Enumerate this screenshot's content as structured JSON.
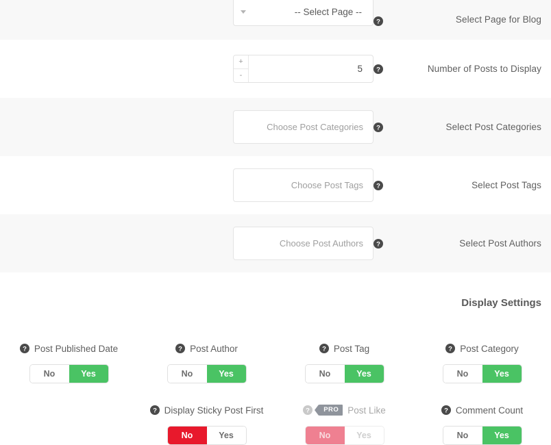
{
  "rows": [
    {
      "label": "Select Page for Blog",
      "control": "select",
      "value": "-- Select Page --",
      "help": "help-icon"
    },
    {
      "label": "Number of Posts to Display",
      "control": "spinner",
      "value": "5",
      "increment_label": "+",
      "decrement_label": "-",
      "help": "help-icon"
    },
    {
      "label": "Select Post Categories",
      "control": "token",
      "placeholder": "Choose Post Categories",
      "help": "help-icon"
    },
    {
      "label": "Select Post Tags",
      "control": "token",
      "placeholder": "Choose Post Tags",
      "help": "help-icon"
    },
    {
      "label": "Select Post Authors",
      "control": "token",
      "placeholder": "Choose Post Authors",
      "help": "help-icon"
    }
  ],
  "display_settings": {
    "heading": "Display Settings",
    "toggle_options": {
      "no": "No",
      "yes": "Yes"
    },
    "toggles": [
      {
        "label": "Post Published Date",
        "state": "yes",
        "style": "green",
        "pro": false,
        "disabled": false
      },
      {
        "label": "Post Author",
        "state": "yes",
        "style": "green",
        "pro": false,
        "disabled": false
      },
      {
        "label": "Post Tag",
        "state": "yes",
        "style": "green",
        "pro": false,
        "disabled": false
      },
      {
        "label": "Post Category",
        "state": "yes",
        "style": "green",
        "pro": false,
        "disabled": false
      },
      {
        "label": "Display Sticky Post First",
        "state": "no",
        "style": "red",
        "pro": false,
        "disabled": false
      },
      {
        "label": "Post Like",
        "state": "no",
        "style": "red",
        "pro": true,
        "pro_label": "PRO",
        "disabled": true
      },
      {
        "label": "Comment Count",
        "state": "yes",
        "style": "green",
        "pro": false,
        "disabled": false
      }
    ]
  },
  "colors": {
    "toggle_green": "#4ac364",
    "toggle_red": "#e8192c",
    "toggle_red_disabled": "#ef8091",
    "row_alt_background": "#f8f8f8",
    "label_text": "#5f5f5f",
    "placeholder_text": "#9f9f9f",
    "pro_badge": "#8f949c"
  }
}
